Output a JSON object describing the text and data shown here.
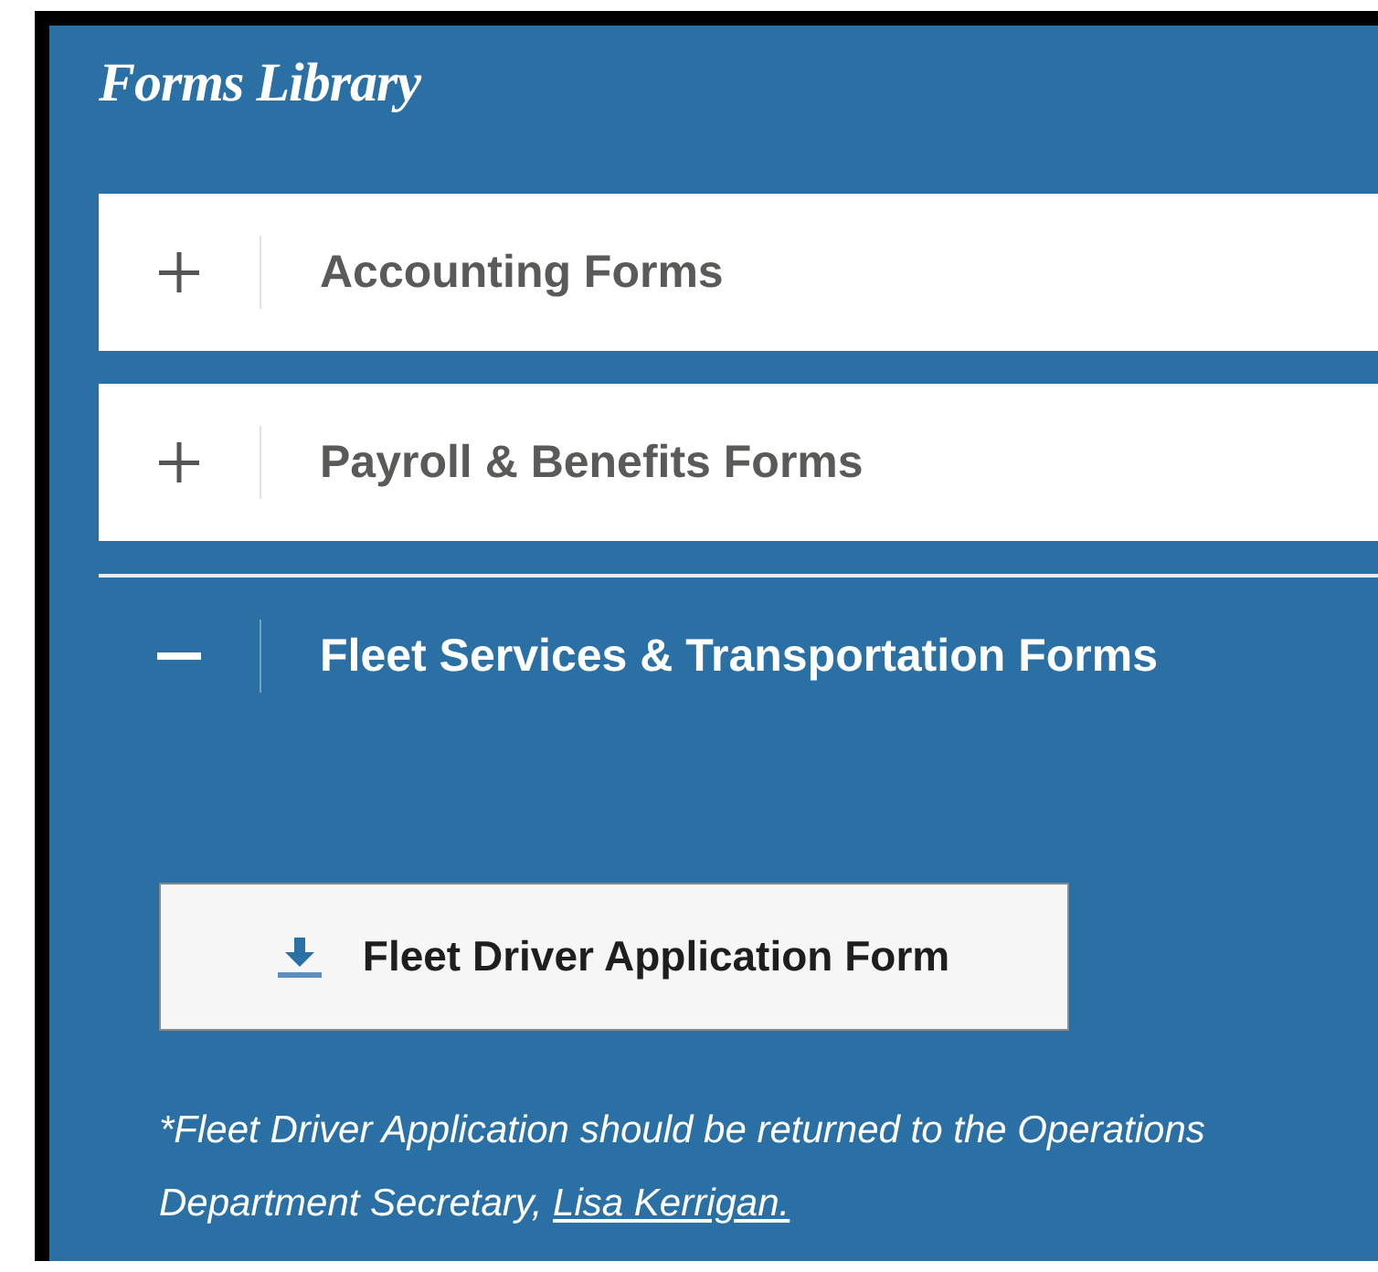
{
  "title": "Forms Library",
  "sections": [
    {
      "label": "Accounting Forms",
      "expanded": false
    },
    {
      "label": "Payroll & Benefits Forms",
      "expanded": false
    },
    {
      "label": "Fleet Services & Transportation Forms",
      "expanded": true,
      "downloads": [
        {
          "label": "Fleet Driver Application Form"
        }
      ],
      "note": {
        "text": "*Fleet Driver Application should be returned to the Operations Department Secretary,",
        "link": "Lisa Kerrigan."
      }
    }
  ]
}
